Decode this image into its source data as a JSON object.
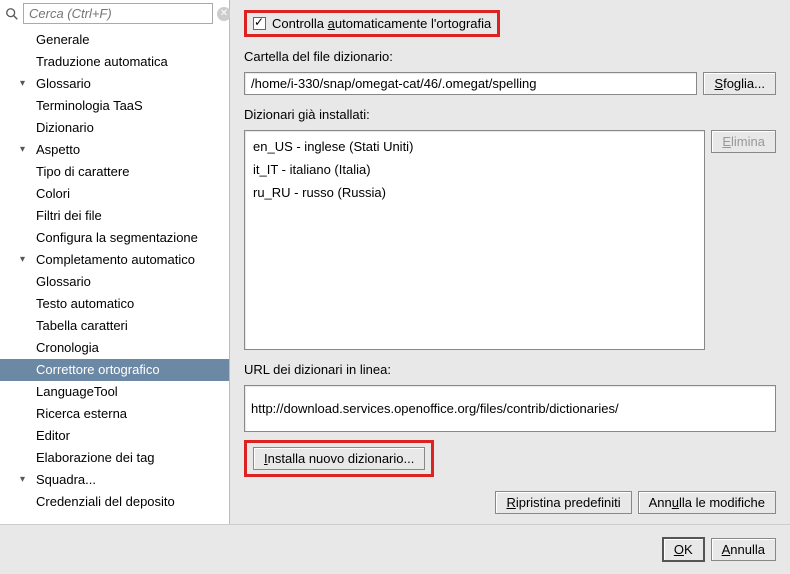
{
  "search": {
    "placeholder": "Cerca (Ctrl+F)"
  },
  "tree": {
    "items": [
      {
        "label": "Generale",
        "level": 0,
        "expandable": false
      },
      {
        "label": "Traduzione automatica",
        "level": 0,
        "expandable": false
      },
      {
        "label": "Glossario",
        "level": 0,
        "expandable": true
      },
      {
        "label": "Terminologia TaaS",
        "level": 1,
        "expandable": false
      },
      {
        "label": "Dizionario",
        "level": 0,
        "expandable": false
      },
      {
        "label": "Aspetto",
        "level": 0,
        "expandable": true
      },
      {
        "label": "Tipo di carattere",
        "level": 1,
        "expandable": false
      },
      {
        "label": "Colori",
        "level": 1,
        "expandable": false
      },
      {
        "label": "Filtri dei file",
        "level": 0,
        "expandable": false
      },
      {
        "label": "Configura la segmentazione",
        "level": 0,
        "expandable": false
      },
      {
        "label": "Completamento automatico",
        "level": 0,
        "expandable": true
      },
      {
        "label": "Glossario",
        "level": 1,
        "expandable": false
      },
      {
        "label": "Testo automatico",
        "level": 1,
        "expandable": false
      },
      {
        "label": "Tabella caratteri",
        "level": 1,
        "expandable": false
      },
      {
        "label": "Cronologia",
        "level": 1,
        "expandable": false
      },
      {
        "label": "Correttore ortografico",
        "level": 0,
        "expandable": false,
        "selected": true
      },
      {
        "label": "LanguageTool",
        "level": 0,
        "expandable": false
      },
      {
        "label": "Ricerca esterna",
        "level": 0,
        "expandable": false
      },
      {
        "label": "Editor",
        "level": 0,
        "expandable": false
      },
      {
        "label": "Elaborazione dei tag",
        "level": 0,
        "expandable": false
      },
      {
        "label": "Squadra...",
        "level": 0,
        "expandable": true
      },
      {
        "label": "Credenziali del deposito",
        "level": 1,
        "expandable": false
      }
    ]
  },
  "main": {
    "auto_check_label_pre": "Controlla ",
    "auto_check_label_u": "a",
    "auto_check_label_post": "utomaticamente l'ortografia",
    "auto_check_checked": true,
    "folder_label": "Cartella del file dizionario:",
    "folder_value": "/home/i-330/snap/omegat-cat/46/.omegat/spelling",
    "browse_label": "Sfoglia...",
    "installed_label": "Dizionari già installati:",
    "delete_label": "Elimina",
    "installed": [
      "en_US - inglese (Stati Uniti)",
      "it_IT - italiano (Italia)",
      "ru_RU - russo (Russia)"
    ],
    "url_label": "URL dei dizionari in linea:",
    "url_value": "http://download.services.openoffice.org/files/contrib/dictionaries/",
    "install_label": "Installa nuovo dizionario...",
    "restore_label": "Ripristina predefiniti",
    "undo_pre": "Ann",
    "undo_u": "u",
    "undo_post": "lla le modifiche"
  },
  "footer": {
    "ok_label": "OK",
    "cancel_label": "Annulla"
  }
}
